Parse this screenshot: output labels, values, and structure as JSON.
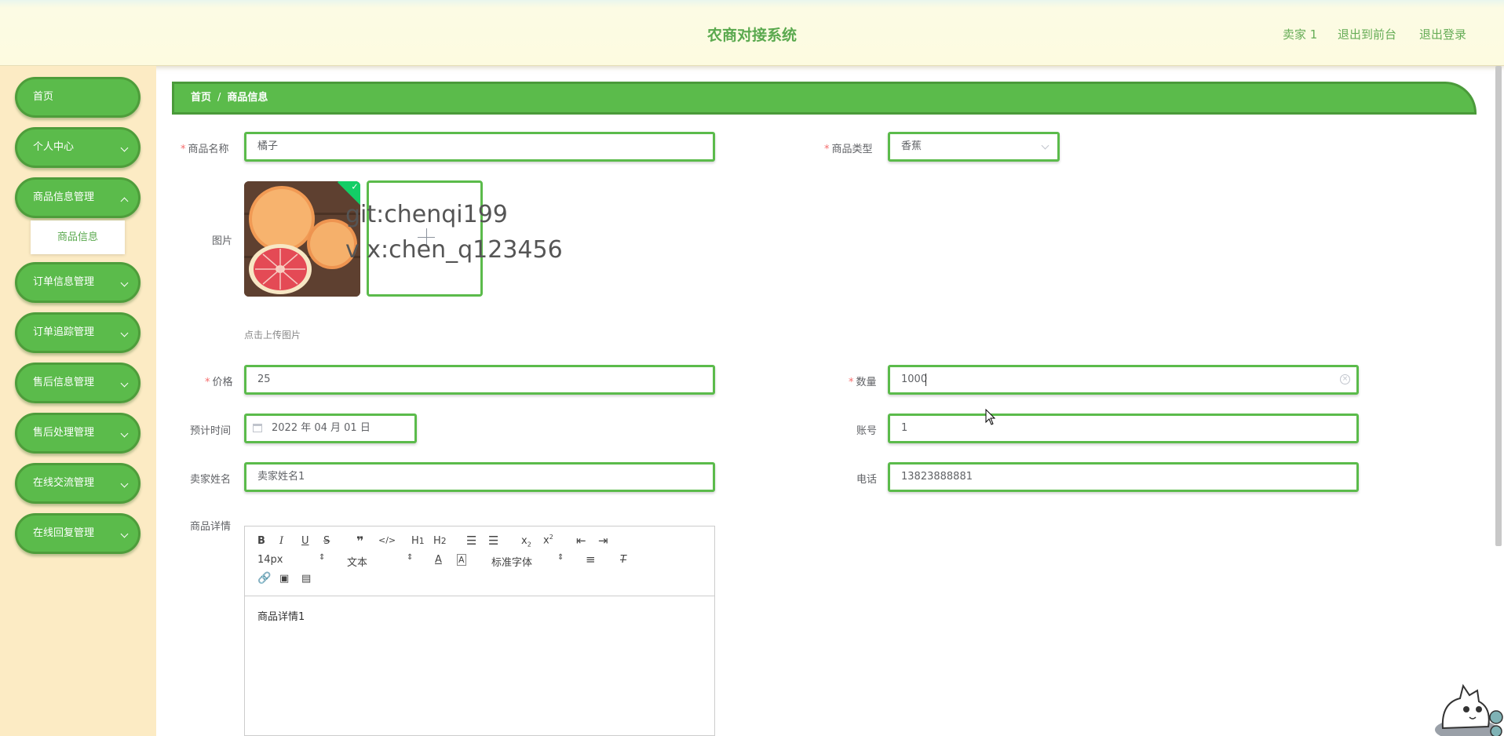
{
  "header": {
    "title": "农商对接系统",
    "links": [
      "卖家 1",
      "退出到前台",
      "退出登录"
    ]
  },
  "sidebar": {
    "items": [
      {
        "label": "首页"
      },
      {
        "label": "个人中心"
      },
      {
        "label": "商品信息管理"
      },
      {
        "label": "订单信息管理"
      },
      {
        "label": "订单追踪管理"
      },
      {
        "label": "售后信息管理"
      },
      {
        "label": "售后处理管理"
      },
      {
        "label": "在线交流管理"
      },
      {
        "label": "在线回复管理"
      }
    ],
    "subitem": "商品信息"
  },
  "breadcrumb": {
    "home": "首页",
    "separator": "/",
    "current": "商品信息"
  },
  "form": {
    "name": {
      "label": "商品名称",
      "value": "橘子"
    },
    "type": {
      "label": "商品类型",
      "value": "香蕉"
    },
    "image": {
      "label": "图片",
      "tip": "点击上传图片"
    },
    "price": {
      "label": "价格",
      "value": "25"
    },
    "quantity": {
      "label": "数量",
      "value": "1000"
    },
    "date": {
      "label": "预计时间",
      "value": "2022 年 04 月 01 日"
    },
    "account": {
      "label": "账号",
      "value": "1"
    },
    "seller": {
      "label": "卖家姓名",
      "value": "卖家姓名1"
    },
    "phone": {
      "label": "电话",
      "value": "13823888881"
    },
    "detail": {
      "label": "商品详情",
      "content": "商品详情1"
    }
  },
  "editor": {
    "font_size": "14px",
    "block_type": "文本",
    "font_family": "标准字体"
  },
  "watermark": [
    "git:chenqi199",
    "v x:chen_q123456"
  ],
  "colors": {
    "primary": "#5bbb4b",
    "sidebar_bg": "#fcebc4",
    "title": "#5aa94e",
    "required": "#f56c6c"
  }
}
